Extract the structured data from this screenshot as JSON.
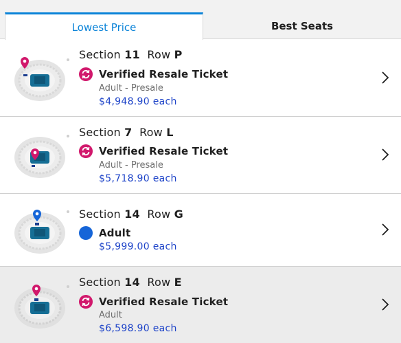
{
  "tabs": {
    "lowest_price": "Lowest Price",
    "best_seats": "Best Seats"
  },
  "listings": [
    {
      "section_word": "Section",
      "section_num": "11",
      "row_word": "Row",
      "row_letter": "P",
      "ticket_type": "Verified Resale Ticket",
      "ticket_icon": "resale-icon",
      "subtitle": "Adult - Presale",
      "price": "$4,948.90 each",
      "pin_color": "#d1186c"
    },
    {
      "section_word": "Section",
      "section_num": "7",
      "row_word": "Row",
      "row_letter": "L",
      "ticket_type": "Verified Resale Ticket",
      "ticket_icon": "resale-icon",
      "subtitle": "Adult - Presale",
      "price": "$5,718.90 each",
      "pin_color": "#d1186c"
    },
    {
      "section_word": "Section",
      "section_num": "14",
      "row_word": "Row",
      "row_letter": "G",
      "ticket_type": "Adult",
      "ticket_icon": "standard-ticket-dot-icon",
      "subtitle": "",
      "price": "$5,999.00 each",
      "pin_color": "#1565d8"
    },
    {
      "section_word": "Section",
      "section_num": "14",
      "row_word": "Row",
      "row_letter": "E",
      "ticket_type": "Verified Resale Ticket",
      "ticket_icon": "resale-icon",
      "subtitle": "Adult",
      "price": "$6,598.90 each",
      "pin_color": "#d1186c"
    }
  ],
  "colors": {
    "accent": "#0a83d8",
    "price": "#1d43c8",
    "resale": "#d1186c",
    "standard": "#1565d8",
    "selected_row": "#ececec"
  }
}
